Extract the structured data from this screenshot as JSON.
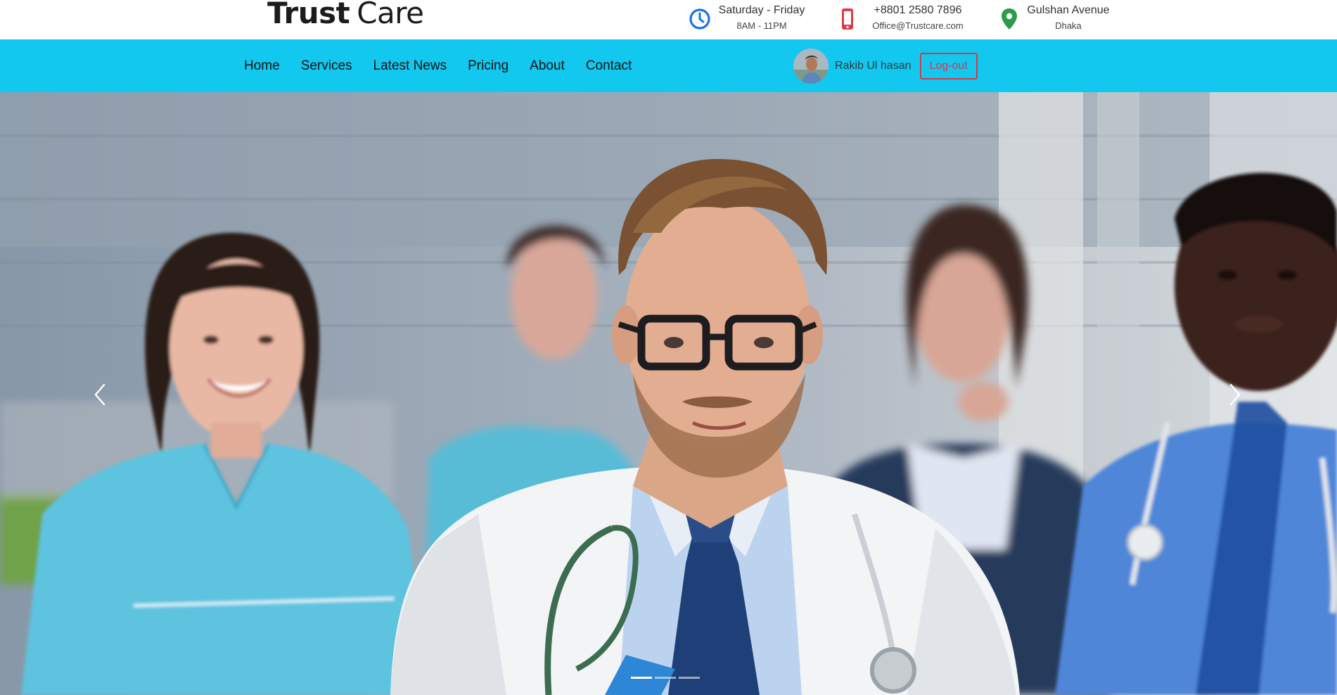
{
  "brand": {
    "part1": "Trust",
    "part2": "Care"
  },
  "contact": {
    "hours": {
      "line1": "Saturday - Friday",
      "line2": "8AM - 11PM",
      "icon": "clock-icon"
    },
    "phone": {
      "line1": "+8801 2580 7896",
      "line2": "Office@Trustcare.com",
      "icon": "phone-icon"
    },
    "address": {
      "line1": "Gulshan Avenue",
      "line2": "Dhaka",
      "icon": "map-pin-icon"
    }
  },
  "nav": {
    "items": [
      "Home",
      "Services",
      "Latest News",
      "Pricing",
      "About",
      "Contact"
    ]
  },
  "user": {
    "name": "Rakib Ul hasan",
    "logout_label": "Log-out"
  },
  "hero": {
    "slide_count": 3,
    "active_slide": 1,
    "prev_icon": "chevron-left-icon",
    "next_icon": "chevron-right-icon"
  },
  "colors": {
    "navbar": "#12c8ee",
    "clock_icon": "#1a73e8",
    "phone_icon": "#e53945",
    "pin_icon": "#2e9b4b",
    "logout": "#d6394a"
  }
}
